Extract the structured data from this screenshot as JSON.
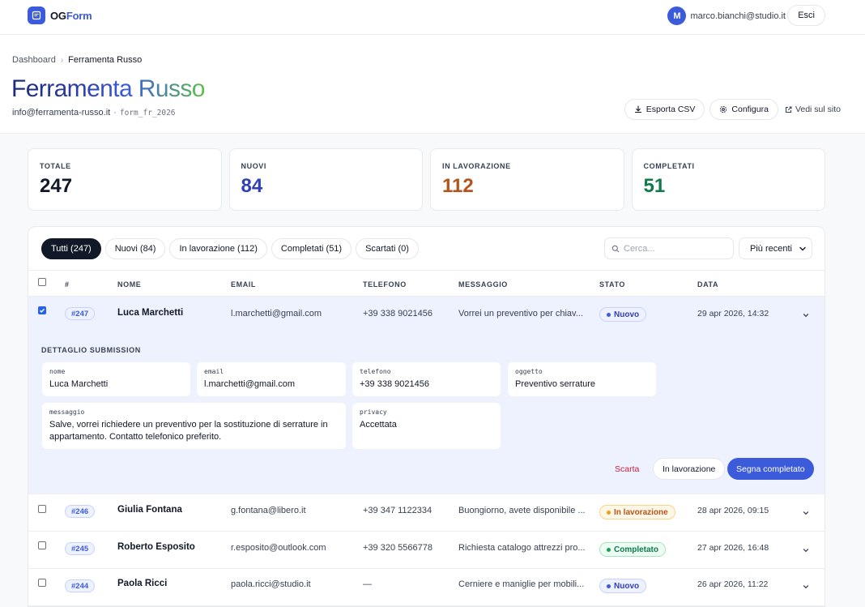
{
  "app": {
    "logo_og": "OG",
    "logo_form": "Form",
    "accent": "#3b5bdb"
  },
  "user": {
    "initial": "M",
    "email": "marco.bianchi@studio.it",
    "logout": "Esci"
  },
  "breadcrumb": {
    "home": "Dashboard",
    "current": "Ferramenta Russo"
  },
  "page": {
    "title": "Ferramenta Russo",
    "email": "info@ferramenta-russo.it",
    "separator": "·",
    "form_code": "form_fr_2026"
  },
  "actions": {
    "export": "Esporta CSV",
    "configure": "Configura",
    "view_site": "Vedi sul sito"
  },
  "stats": [
    {
      "label": "TOTALE",
      "value": "247",
      "color": "#111827"
    },
    {
      "label": "NUOVI",
      "value": "84",
      "color": "#2f3fb8"
    },
    {
      "label": "IN LAVORAZIONE",
      "value": "112",
      "color": "#b4541a"
    },
    {
      "label": "COMPLETATI",
      "value": "51",
      "color": "#0f7a4a"
    }
  ],
  "filters": [
    "Tutti (247)",
    "Nuovi (84)",
    "In lavorazione (112)",
    "Completati (51)",
    "Scartati (0)"
  ],
  "search": {
    "placeholder": "Cerca..."
  },
  "sort": {
    "selected": "Più recenti"
  },
  "columns": {
    "id": "#",
    "name": "NOME",
    "email": "EMAIL",
    "phone": "TELEFONO",
    "message": "MESSAGGIO",
    "status": "STATO",
    "date": "DATA"
  },
  "rows": [
    {
      "id": "#247",
      "name": "Luca Marchetti",
      "email": "l.marchetti@gmail.com",
      "phone": "+39 338 9021456",
      "message": "Vorrei un preventivo per chiav...",
      "status": "Nuovo",
      "date": "29 apr 2026, 14:32"
    },
    {
      "id": "#246",
      "name": "Giulia Fontana",
      "email": "g.fontana@libero.it",
      "phone": "+39 347 1122334",
      "message": "Buongiorno, avete disponibile ...",
      "status": "In lavorazione",
      "date": "28 apr 2026, 09:15"
    },
    {
      "id": "#245",
      "name": "Roberto Esposito",
      "email": "r.esposito@outlook.com",
      "phone": "+39 320 5566778",
      "message": "Richiesta catalogo attrezzi pro...",
      "status": "Completato",
      "date": "27 apr 2026, 16:48"
    },
    {
      "id": "#244",
      "name": "Paola Ricci",
      "email": "paola.ricci@studio.it",
      "phone": "—",
      "message": "Cerniere e maniglie per mobili...",
      "status": "Nuovo",
      "date": "26 apr 2026, 11:22"
    }
  ],
  "status_colors": {
    "Nuovo": {
      "bg": "#eef2ff",
      "border": "#c7d2fe",
      "text": "#2f3fb8",
      "dot": "#3b5bdb"
    },
    "In lavorazione": {
      "bg": "#fff7e6",
      "border": "#f7d58a",
      "text": "#b4541a",
      "dot": "#e8a21b"
    },
    "Completato": {
      "bg": "#ecfdf3",
      "border": "#a7e3c0",
      "text": "#0f7a4a",
      "dot": "#16a34a"
    }
  },
  "detail": {
    "title": "DETTAGLIO SUBMISSION",
    "fields": [
      {
        "key": "nome",
        "value": "Luca Marchetti"
      },
      {
        "key": "email",
        "value": "l.marchetti@gmail.com"
      },
      {
        "key": "telefono",
        "value": "+39 338 9021456"
      },
      {
        "key": "oggetto",
        "value": "Preventivo serrature"
      },
      {
        "key": "messaggio",
        "value": "Salve, vorrei richiedere un preventivo per la sostituzione di serrature in appartamento. Contatto telefonico preferito."
      },
      {
        "key": "privacy",
        "value": "Accettata"
      }
    ],
    "discard": "Scarta",
    "in_progress": "In lavorazione",
    "complete": "Segna completato"
  }
}
